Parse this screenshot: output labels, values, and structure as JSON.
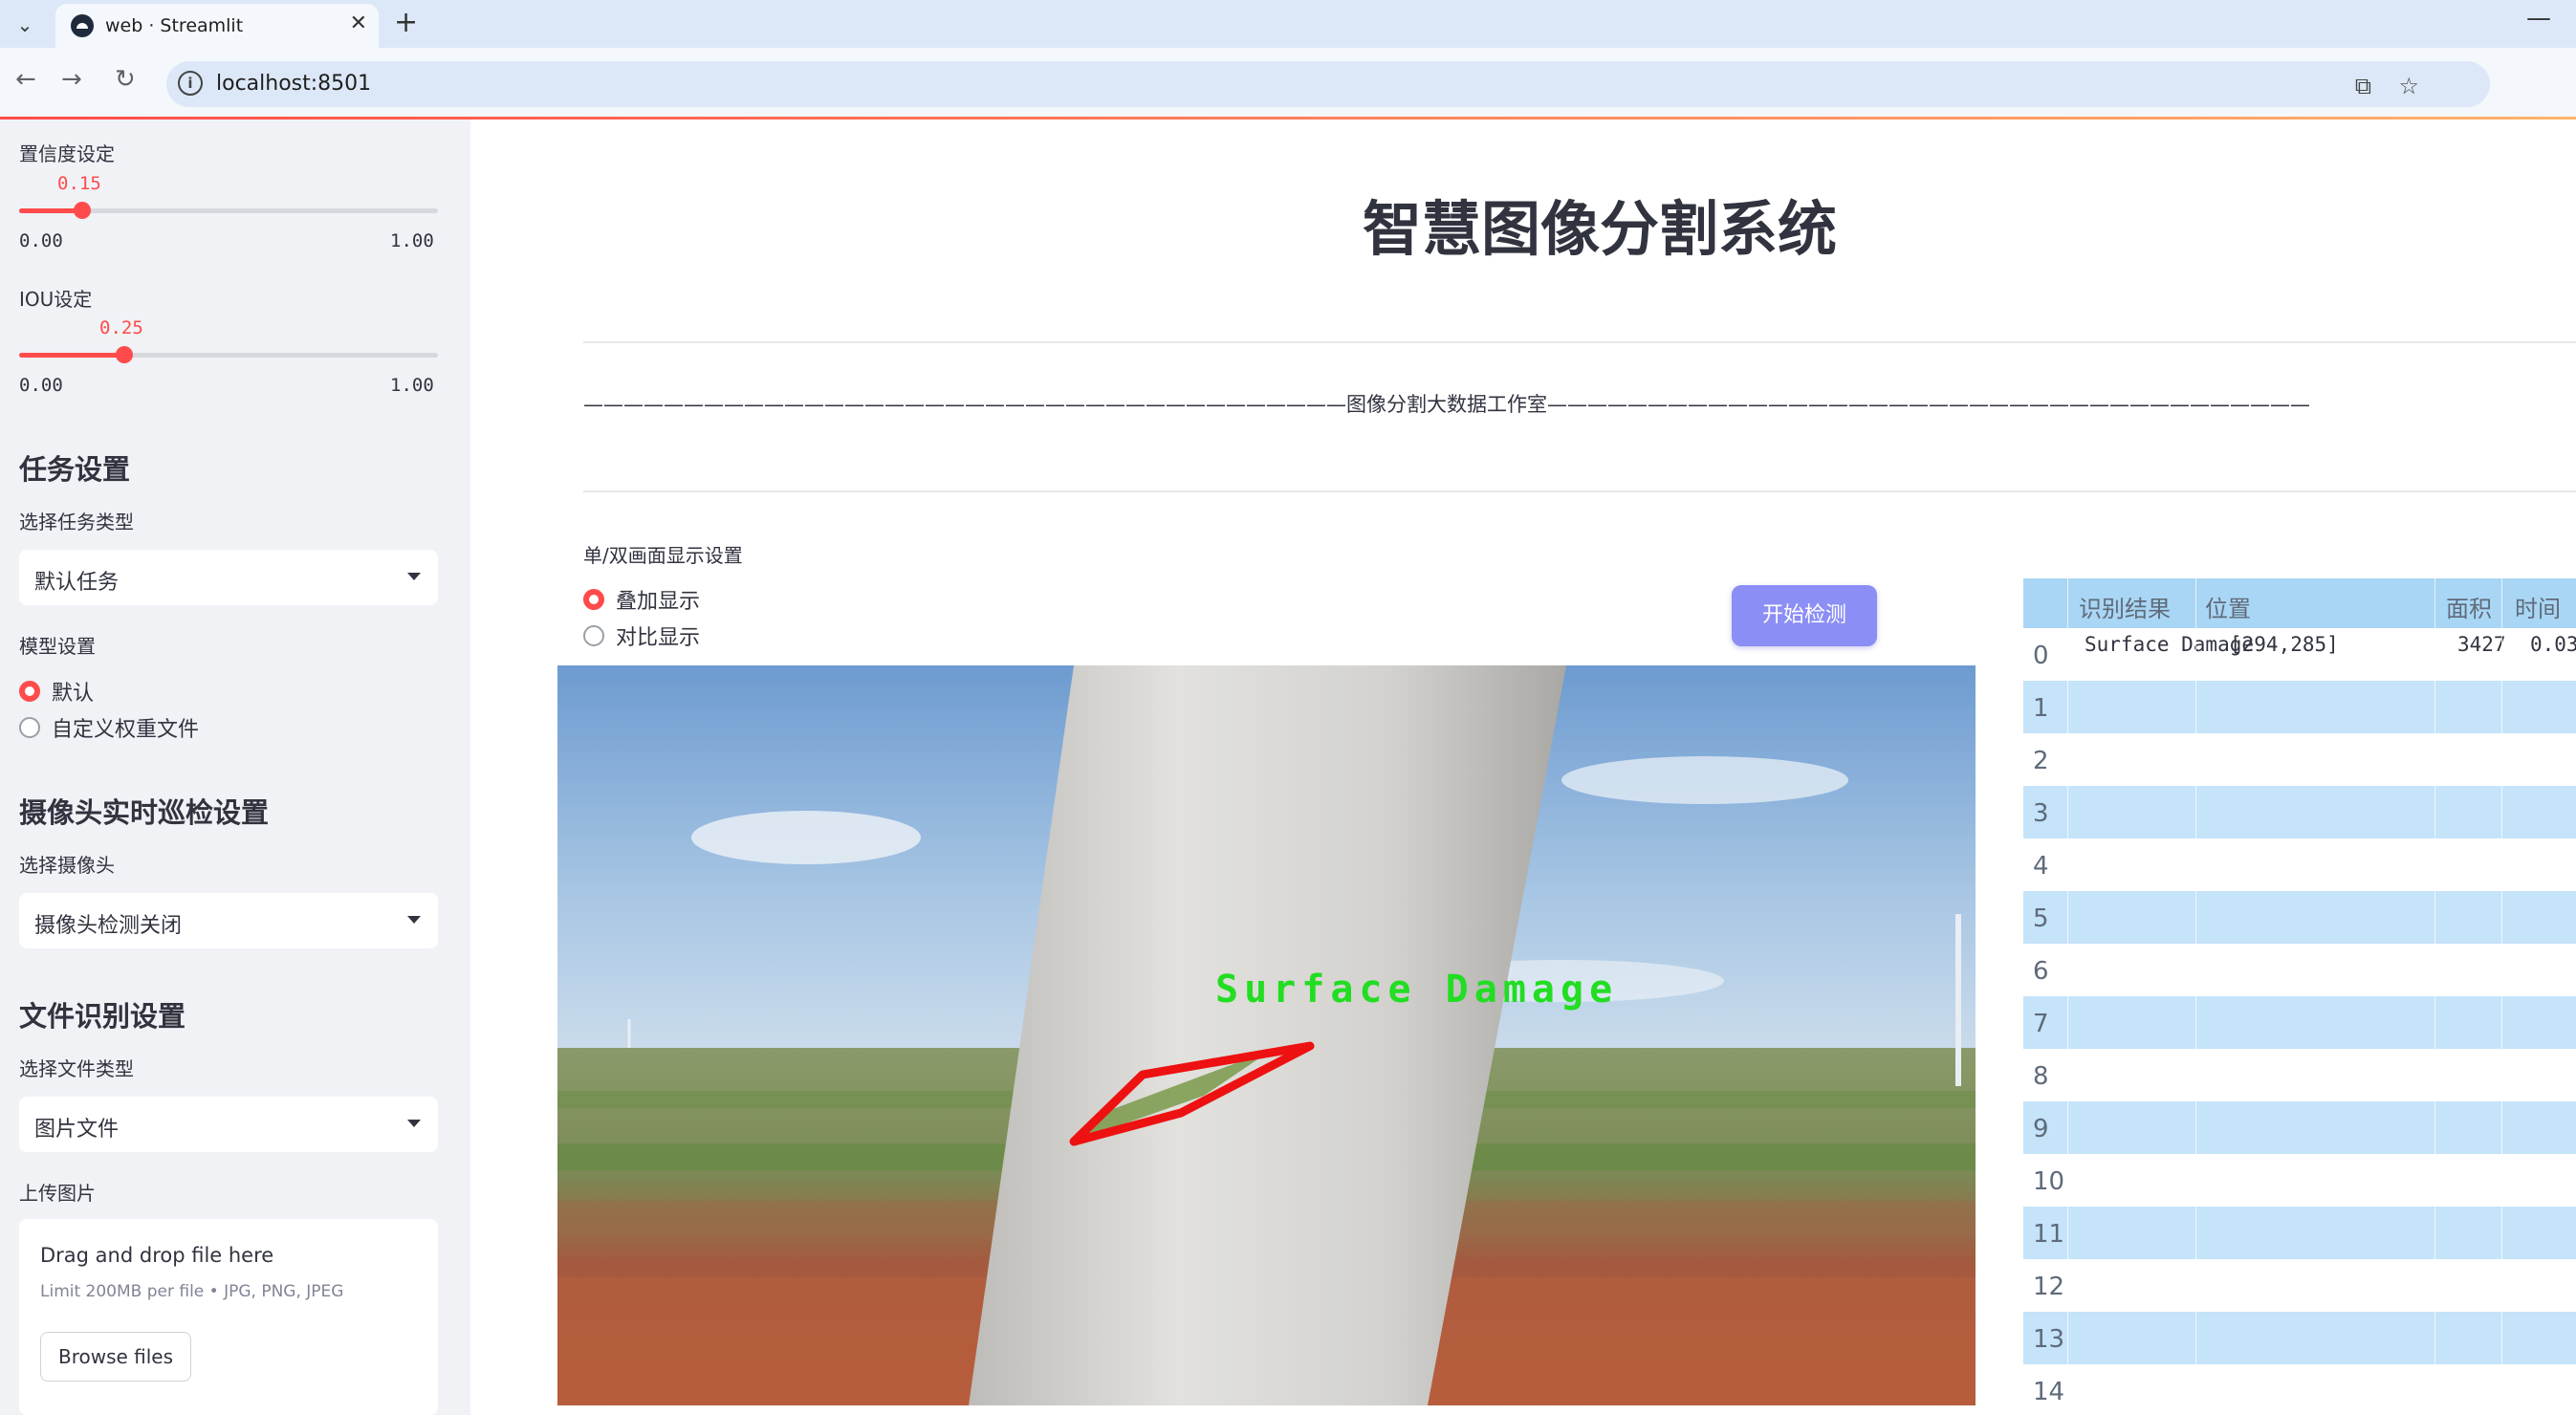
{
  "browser": {
    "tab_title": "web · Streamlit",
    "url": "localhost:8501"
  },
  "sidebar": {
    "confidence": {
      "label": "置信度设定",
      "value": "0.15",
      "min": "0.00",
      "max": "1.00",
      "fraction": 0.15
    },
    "iou": {
      "label": "IOU设定",
      "value": "0.25",
      "min": "0.00",
      "max": "1.00",
      "fraction": 0.25
    },
    "task_section": "任务设置",
    "task_type_label": "选择任务类型",
    "task_type_value": "默认任务",
    "model_label": "模型设置",
    "model_options": [
      "默认",
      "自定义权重文件"
    ],
    "model_selected": 0,
    "camera_section": "摄像头实时巡检设置",
    "camera_label": "选择摄像头",
    "camera_value": "摄像头检测关闭",
    "file_section": "文件识别设置",
    "file_type_label": "选择文件类型",
    "file_type_value": "图片文件",
    "upload_label": "上传图片",
    "upload_title": "Drag and drop file here",
    "upload_limit": "Limit 200MB per file • JPG, PNG, JPEG",
    "browse_label": "Browse files"
  },
  "main": {
    "title": "智慧图像分割系统",
    "studio": "——————————————————————————————————————图像分割大数据工作室——————————————————————————————————————",
    "display_label": "单/双画面显示设置",
    "display_options": [
      "叠加显示",
      "对比显示"
    ],
    "display_selected": 0,
    "detect_button": "开始检测",
    "detection_label": "Surface Damage"
  },
  "table": {
    "headers": [
      "识别结果",
      "位置",
      "面积",
      "时间"
    ],
    "rows": [
      {
        "index": "0",
        "result": "Surface Damage",
        "position": "[294,285]",
        "area": "3427",
        "time": "0.03"
      },
      {
        "index": "1"
      },
      {
        "index": "2"
      },
      {
        "index": "3"
      },
      {
        "index": "4"
      },
      {
        "index": "5"
      },
      {
        "index": "6"
      },
      {
        "index": "7"
      },
      {
        "index": "8"
      },
      {
        "index": "9"
      },
      {
        "index": "10"
      },
      {
        "index": "11"
      },
      {
        "index": "12"
      },
      {
        "index": "13"
      },
      {
        "index": "14"
      }
    ]
  },
  "colors": {
    "accent": "#ff4b4b",
    "button": "#8b8ff5",
    "table_header": "#a9d6f5",
    "table_stripe": "#c5e3f9",
    "sidebar_bg": "#f0f2f6",
    "detection_green": "#22dd22",
    "detection_red": "#ee1111"
  }
}
